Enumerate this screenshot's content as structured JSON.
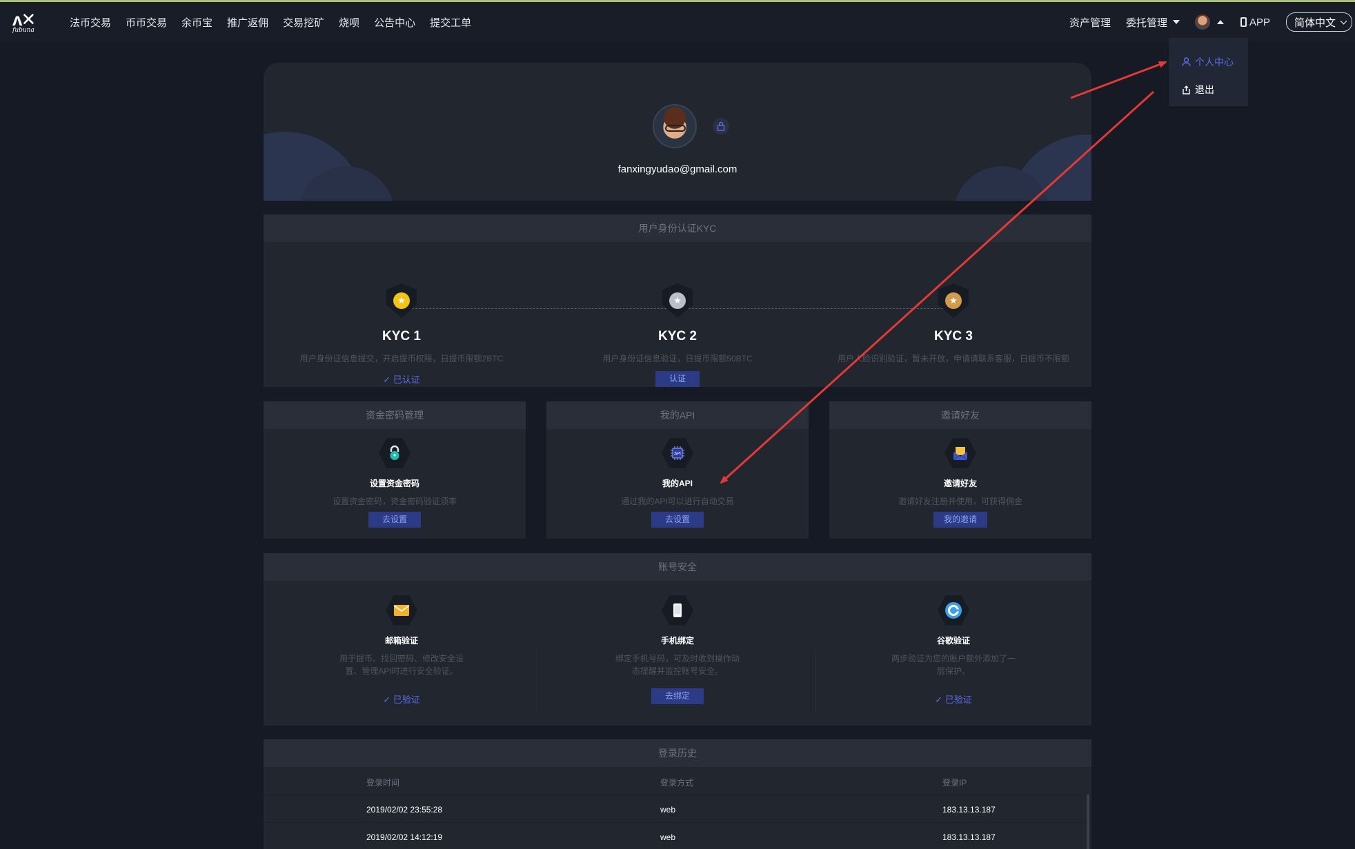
{
  "app": {
    "logo_text": "fubuna"
  },
  "nav": [
    "法币交易",
    "币币交易",
    "余币宝",
    "推广返佣",
    "交易挖矿",
    "烧呗",
    "公告中心",
    "提交工单"
  ],
  "right_nav": {
    "assets": "资产管理",
    "orders": "委托管理",
    "app": "APP",
    "language": "简体中文"
  },
  "user_menu": {
    "personal": "个人中心",
    "logout": "退出"
  },
  "profile": {
    "email": "fanxingyudao@gmail.com"
  },
  "kyc": {
    "title": "用户身份认证KYC",
    "levels": [
      {
        "name": "KYC 1",
        "desc": "用户身份证信息提交，开启提币权限，日提币限额2BTC",
        "status": "已认证"
      },
      {
        "name": "KYC 2",
        "desc": "用户身份证信息验证，日提币限额50BTC",
        "action": "认证"
      },
      {
        "name": "KYC 3",
        "desc": "用户人脸识别验证，暂未开放，申请请联系客服，日提币不限额"
      }
    ]
  },
  "fund_password": {
    "header": "资金密码管理",
    "title": "设置资金密码",
    "desc": "设置资金密码，资金密码验证须率",
    "action": "去设置"
  },
  "api": {
    "header": "我的API",
    "title": "我的API",
    "desc": "通过我的API可以进行自动交易",
    "action": "去设置"
  },
  "invite": {
    "header": "邀请好友",
    "title": "邀请好友",
    "desc": "邀请好友注册并使用，可获得佣金",
    "action": "我的邀请"
  },
  "security": {
    "header": "账号安全",
    "items": [
      {
        "title": "邮箱验证",
        "desc": "用于提币、找回密码、修改安全设置、管理API时进行安全验证。",
        "status": "已验证"
      },
      {
        "title": "手机绑定",
        "desc": "绑定手机号码，可及时收到操作动态提醒并监控账号安全。",
        "action": "去绑定"
      },
      {
        "title": "谷歌验证",
        "desc": "两步验证为您的账户额外添加了一层保护。",
        "status": "已验证"
      }
    ]
  },
  "login_history": {
    "header": "登录历史",
    "columns": [
      "登录时间",
      "登录方式",
      "登录IP"
    ],
    "rows": [
      [
        "2019/02/02 23:55:28",
        "web",
        "183.13.13.187"
      ],
      [
        "2019/02/02 14:12:19",
        "web",
        "183.13.13.187"
      ]
    ]
  },
  "colors": {
    "accent": "#5b6de6",
    "annotation_arrow": "#e53935",
    "background": "#161a24",
    "card": "#22262f"
  }
}
